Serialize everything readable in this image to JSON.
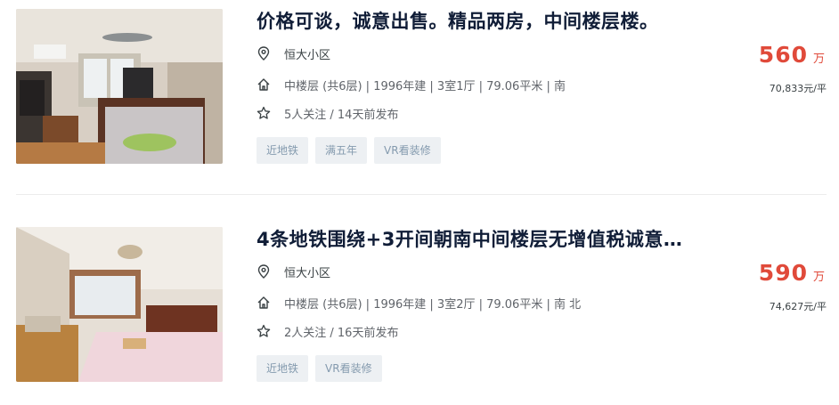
{
  "listings": [
    {
      "title": "价格可谈，诚意出售。精品两房，中间楼层楼。",
      "community": "恒大小区",
      "info": "中楼层 (共6层) | 1996年建 | 3室1厅 | 79.06平米 | 南",
      "follow": "5人关注 / 14天前发布",
      "tags": [
        "近地铁",
        "满五年",
        "VR看装修"
      ],
      "price": "560",
      "price_unit": "万",
      "unit_price": "70,833元/平"
    },
    {
      "title": "4条地铁围绕+3开间朝南中间楼层无增值税诚意…",
      "community": "恒大小区",
      "info": "中楼层 (共6层) | 1996年建 | 3室2厅 | 79.06平米 | 南 北",
      "follow": "2人关注 / 16天前发布",
      "tags": [
        "近地铁",
        "VR看装修"
      ],
      "price": "590",
      "price_unit": "万",
      "unit_price": "74,627元/平"
    }
  ],
  "icons": {
    "community": "location-pin-icon",
    "info": "house-icon",
    "follow": "star-outline-icon"
  },
  "colors": {
    "price": "#e04a3a",
    "title": "#101d37",
    "tag_text": "#849aae",
    "tag_bg": "#edf0f3"
  }
}
